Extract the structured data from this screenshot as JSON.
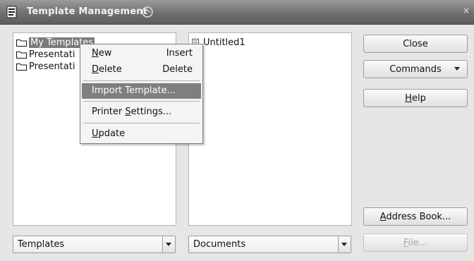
{
  "window": {
    "title": "Template Management"
  },
  "left_tree": {
    "items": [
      {
        "label": "My Templates",
        "selected": true
      },
      {
        "label": "Presentati"
      },
      {
        "label": "Presentati"
      }
    ]
  },
  "right_tree": {
    "items": [
      {
        "label": "Untitled1"
      }
    ]
  },
  "context_menu": {
    "new": {
      "label_u": "N",
      "label_rest": "ew",
      "shortcut": "Insert"
    },
    "delete": {
      "label_u": "D",
      "label_rest": "elete",
      "shortcut": "Delete"
    },
    "import": {
      "label": "Import Template..."
    },
    "printer": {
      "label_pre": "Printer ",
      "label_u": "S",
      "label_rest": "ettings..."
    },
    "update": {
      "label_u": "U",
      "label_rest": "pdate"
    }
  },
  "buttons": {
    "close": "Close",
    "commands": "Commands",
    "help_u": "H",
    "help_rest": "elp",
    "address_u": "A",
    "address_rest": "ddress Book...",
    "file_u": "F",
    "file_rest": "ile..."
  },
  "combos": {
    "left": "Templates",
    "right": "Documents"
  },
  "colors": {
    "titlebar": "#6f6f6f",
    "selection": "#7a7a7a"
  }
}
